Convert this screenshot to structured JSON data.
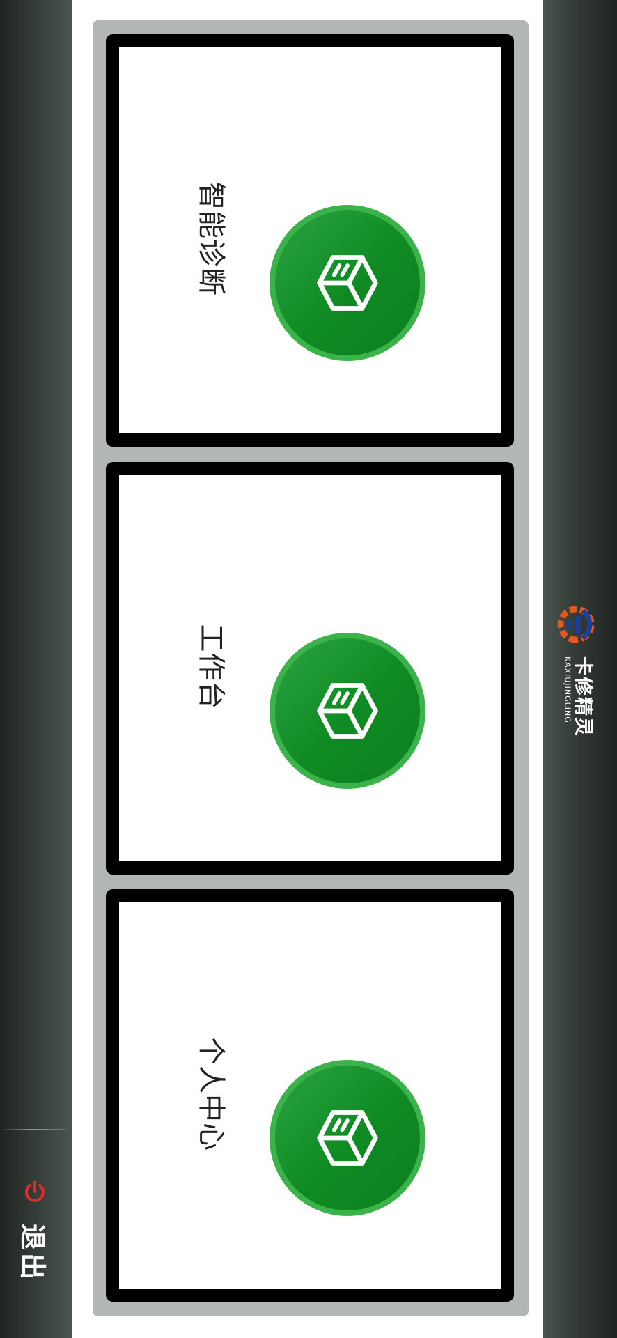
{
  "app": {
    "brand_name": "卡修精灵",
    "brand_sub": "KAXIUJINGLING"
  },
  "sidebar": {
    "logout_label": "退出",
    "logout_icon": "power-icon",
    "logout_icon_color": "#d9302c"
  },
  "menu": {
    "items": [
      {
        "label": "智能诊断",
        "icon": "cube-icon"
      },
      {
        "label": "工作台",
        "icon": "cube-icon"
      },
      {
        "label": "个人中心",
        "icon": "cube-icon"
      }
    ]
  },
  "colors": {
    "accent_green": "#1a9a33",
    "dark_bar": "#2b312d",
    "panel_gray": "#b2b6b4",
    "logo_orange": "#e8581c",
    "logo_blue": "#1c3f96"
  }
}
